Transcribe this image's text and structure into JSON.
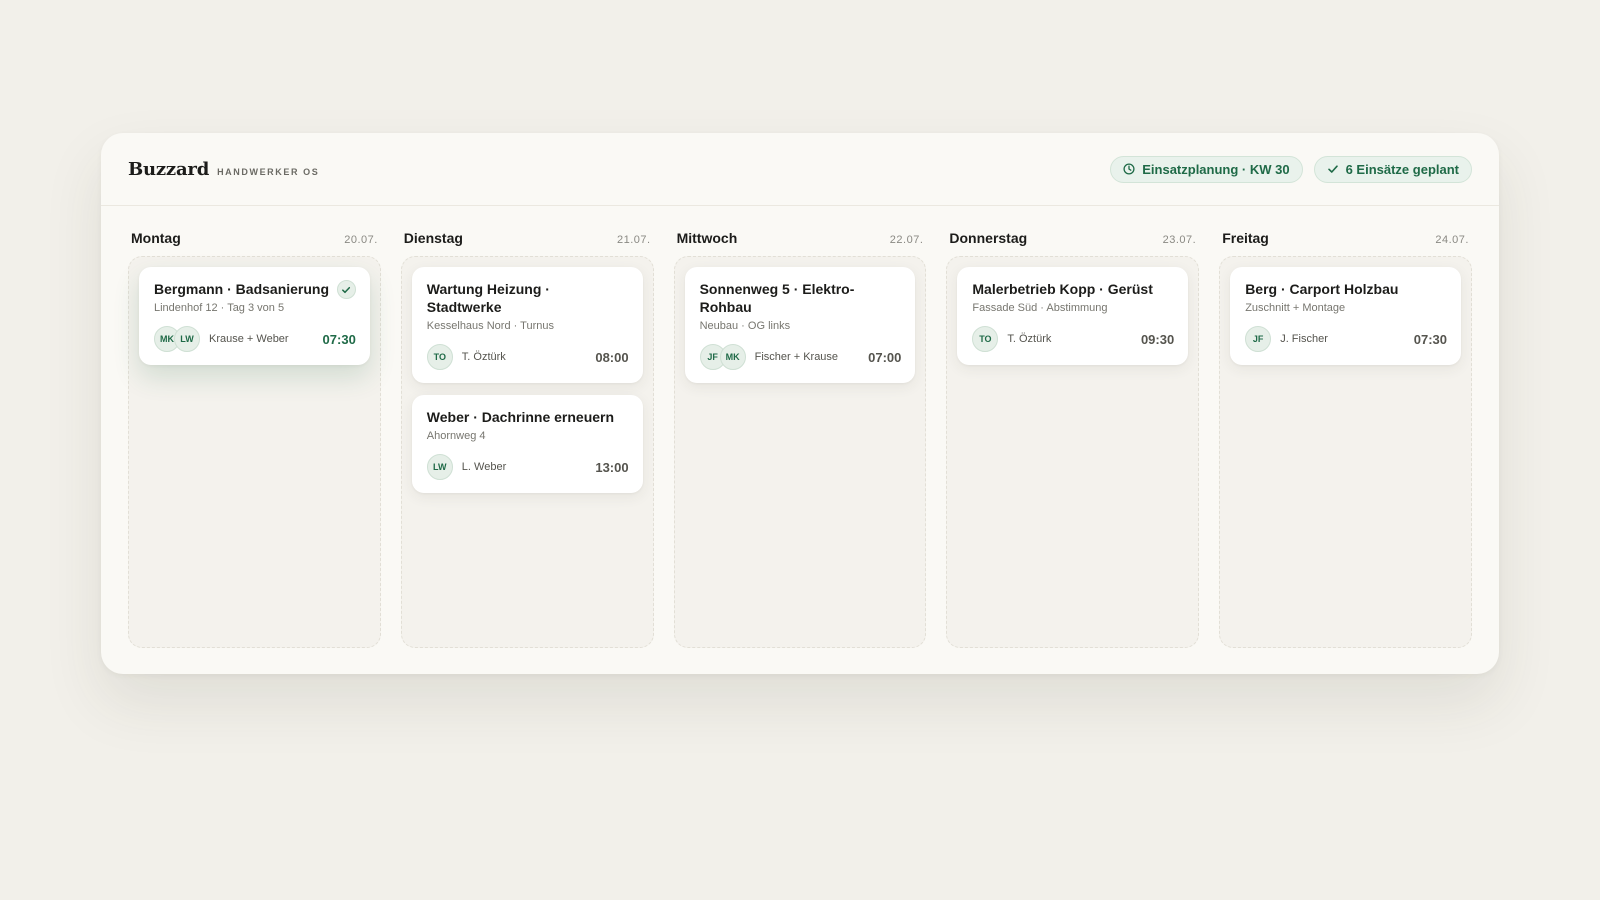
{
  "brand": {
    "name": "Buzzard",
    "sub": "HANDWERKER OS"
  },
  "pills": [
    {
      "label": "Einsatzplanung · KW 30",
      "icon": "clock-icon"
    },
    {
      "label": "6 Einsätze geplant",
      "icon": "check-icon"
    }
  ],
  "colors": {
    "accent": "#1f6a47",
    "background": "#f2f0ea",
    "panel": "#faf9f5"
  },
  "days": [
    {
      "name": "Montag",
      "date": "20.07.",
      "cards": [
        {
          "title": "Bergmann · Badsanierung",
          "sub": "Lindenhof 12 · Tag 3 von 5",
          "avatars": [
            "MK",
            "LW"
          ],
          "crew": "Krause + Weber",
          "time": "07:30",
          "done_icon": "check-icon"
        }
      ]
    },
    {
      "name": "Dienstag",
      "date": "21.07.",
      "cards": [
        {
          "title": "Wartung Heizung · Stadtwerke",
          "sub": "Kesselhaus Nord · Turnus",
          "avatars": [
            "TO"
          ],
          "crew": "T. Öztürk",
          "time": "08:00"
        },
        {
          "title": "Weber · Dachrinne erneuern",
          "sub": "Ahornweg 4",
          "avatars": [
            "LW"
          ],
          "crew": "L. Weber",
          "time": "13:00"
        }
      ]
    },
    {
      "name": "Mittwoch",
      "date": "22.07.",
      "cards": [
        {
          "title": "Sonnenweg 5 · Elektro-Rohbau",
          "sub": "Neubau · OG links",
          "avatars": [
            "JF",
            "MK"
          ],
          "crew": "Fischer + Krause",
          "time": "07:00"
        }
      ]
    },
    {
      "name": "Donnerstag",
      "date": "23.07.",
      "cards": [
        {
          "title": "Malerbetrieb Kopp · Gerüst",
          "sub": "Fassade Süd · Abstimmung",
          "avatars": [
            "TO"
          ],
          "crew": "T. Öztürk",
          "time": "09:30"
        }
      ]
    },
    {
      "name": "Freitag",
      "date": "24.07.",
      "cards": [
        {
          "title": "Berg · Carport Holzbau",
          "sub": "Zuschnitt + Montage",
          "avatars": [
            "JF"
          ],
          "crew": "J. Fischer",
          "time": "07:30"
        }
      ]
    }
  ]
}
